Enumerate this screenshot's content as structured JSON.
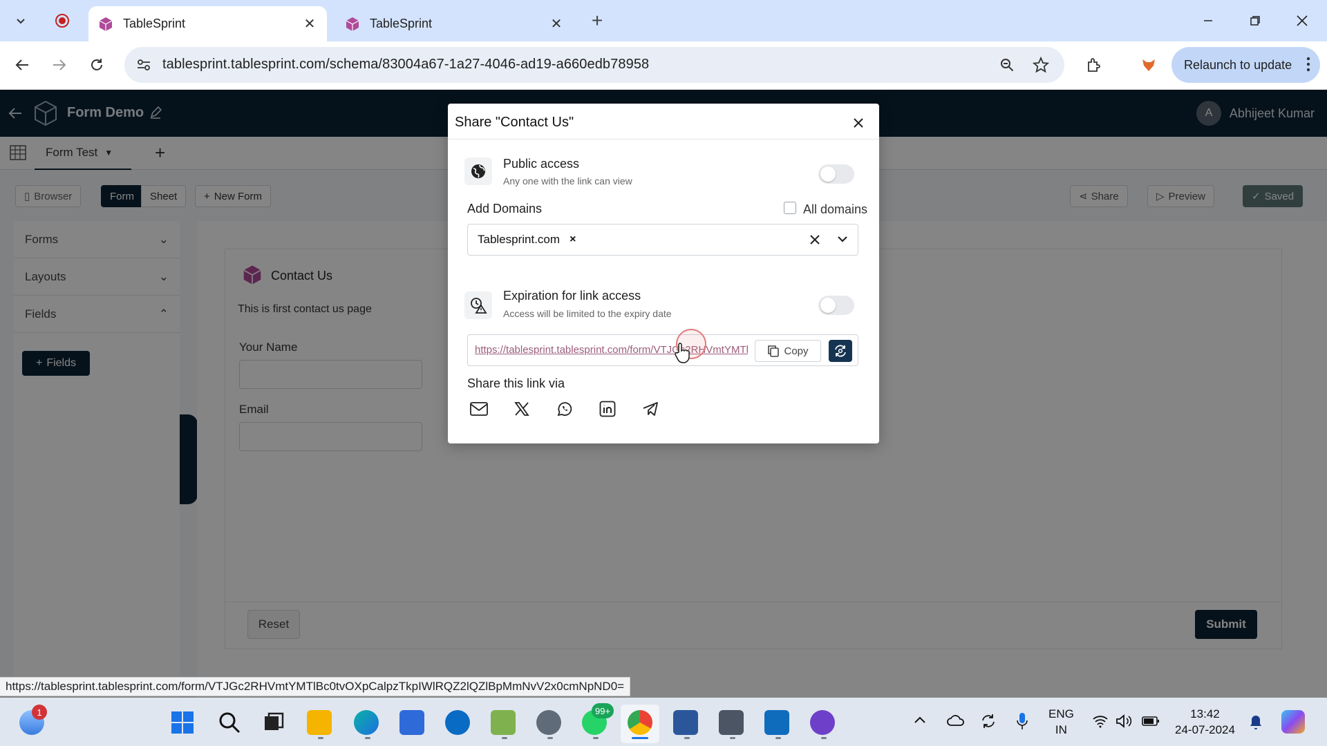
{
  "browser": {
    "tabs": [
      {
        "title": "TableSprint",
        "active": true
      },
      {
        "title": "TableSprint",
        "active": false
      }
    ],
    "url": "tablesprint.tablesprint.com/schema/83004a67-1a27-4046-ad19-a660edb78958",
    "relaunch_label": "Relaunch to update",
    "status_url": "https://tablesprint.tablesprint.com/form/VTJGc2RHVmtYMTlBc0tvOXpCalpzTkpIWlRQZ2lQZlBpMmNvV2x0cmNpND0="
  },
  "app": {
    "title": "Form Demo",
    "user_initial": "A",
    "user_name": "Abhijeet Kumar",
    "sheet_tab": "Form Test",
    "toolbar": {
      "browser": "Browser",
      "form": "Form",
      "sheet": "Sheet",
      "new_form": "New Form",
      "share": "Share",
      "preview": "Preview",
      "saved": "Saved"
    },
    "sidebar": {
      "items": [
        {
          "label": "Forms",
          "chevron": "down"
        },
        {
          "label": "Layouts",
          "chevron": "down"
        },
        {
          "label": "Fields",
          "chevron": "up"
        }
      ],
      "fields_button": "Fields"
    },
    "form": {
      "title": "Contact Us",
      "description": "This is first contact us page",
      "fields": [
        {
          "label": "Your Name"
        },
        {
          "label": "Email"
        }
      ],
      "reset": "Reset",
      "submit": "Submit"
    }
  },
  "modal": {
    "title": "Share \"Contact Us\"",
    "public_access": {
      "title": "Public access",
      "subtitle": "Any one with the link can view",
      "enabled": false
    },
    "domains": {
      "label": "Add Domains",
      "all_domains_label": "All domains",
      "all_domains_checked": false,
      "chips": [
        "Tablesprint.com"
      ]
    },
    "expiration": {
      "title": "Expiration for link access",
      "subtitle": "Access will be limited to the expiry date",
      "enabled": false
    },
    "link": "https://tablesprint.tablesprint.com/form/VTJGc2RHVmtYMTlBc0tvOXpCalpzTkpIWlRQZ2lQZlBpMmNvV2x0cmNpND0=",
    "copy_label": "Copy",
    "share_via_label": "Share this link via",
    "share_icons": [
      "mail-icon",
      "x-icon",
      "whatsapp-icon",
      "linkedin-icon",
      "telegram-icon"
    ]
  },
  "taskbar": {
    "weather_badge": "1",
    "whatsapp_badge": "99+",
    "lang_top": "ENG",
    "lang_bottom": "IN",
    "time": "13:42",
    "date": "24-07-2024"
  },
  "colors": {
    "app_header": "#0d2335",
    "primary": "#153451",
    "tab_bar": "#d3e3fd"
  }
}
